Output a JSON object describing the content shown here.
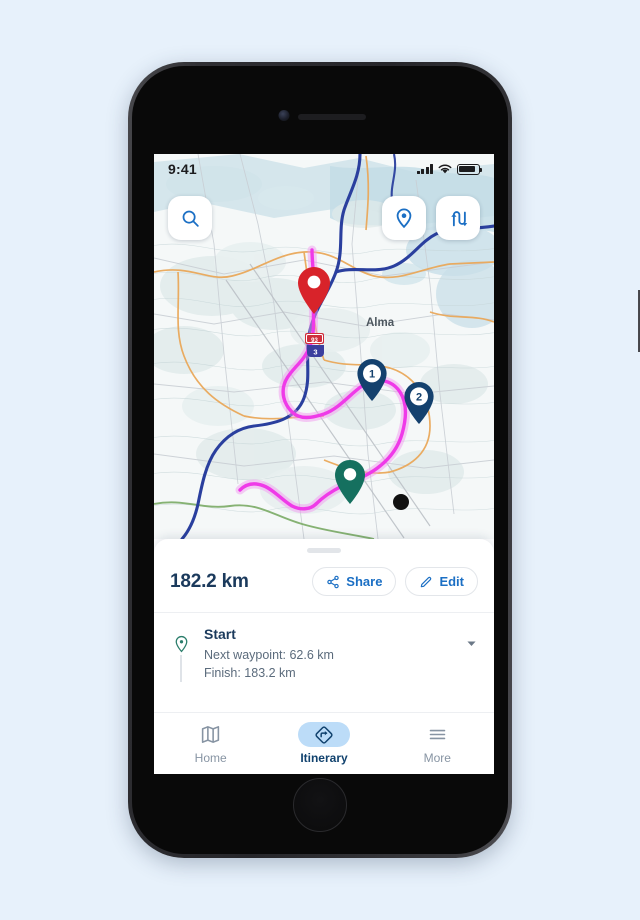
{
  "page": {
    "background_color": "#e7f1fb"
  },
  "status_bar": {
    "time": "9:41",
    "signal_icon": "cellular-signal-icon",
    "wifi_icon": "wifi-icon",
    "battery_icon": "battery-icon"
  },
  "map": {
    "city_label": "Alma",
    "route_color": "#ef3ae8",
    "road_color": "#2a3f9e",
    "highway_shield": {
      "label": "93",
      "secondary": "3"
    },
    "markers": [
      {
        "name": "destination-marker",
        "label": "",
        "color": "#d8232a",
        "type": "pin"
      },
      {
        "name": "waypoint-marker-1",
        "label": "1",
        "color": "#14416e",
        "type": "pin"
      },
      {
        "name": "waypoint-marker-2",
        "label": "2",
        "color": "#14416e",
        "type": "pin"
      },
      {
        "name": "start-marker",
        "label": "",
        "color": "#15705f",
        "type": "pin"
      },
      {
        "name": "current-position-dot",
        "label": "",
        "color": "#111111",
        "type": "dot"
      }
    ],
    "controls": [
      {
        "name": "search-button",
        "icon": "search-icon"
      },
      {
        "name": "locate-button",
        "icon": "map-pin-icon"
      },
      {
        "name": "directions-button",
        "icon": "route-swap-icon"
      }
    ]
  },
  "sheet": {
    "grabber": "drag-handle",
    "distance": "182.2 km",
    "actions": [
      {
        "label": "Share",
        "icon": "share-nodes-icon"
      },
      {
        "label": "Edit",
        "icon": "pencil-icon"
      }
    ],
    "leg": {
      "icon": "start-pin-icon",
      "title": "Start",
      "next_waypoint": "Next waypoint: 62.6 km",
      "finish": "Finish: 183.2 km",
      "expand_icon": "chevron-down-icon"
    }
  },
  "tabbar": {
    "tabs": [
      {
        "label": "Home",
        "icon": "map-folded-icon",
        "active": false
      },
      {
        "label": "Itinerary",
        "icon": "directions-diamond-icon",
        "active": true
      },
      {
        "label": "More",
        "icon": "hamburger-icon",
        "active": false
      }
    ]
  },
  "theme": {
    "accent": "#1b6fc4",
    "dark_blue": "#1b3a5c",
    "active_pill": "#bcdcf8",
    "muted": "#8794a3"
  }
}
